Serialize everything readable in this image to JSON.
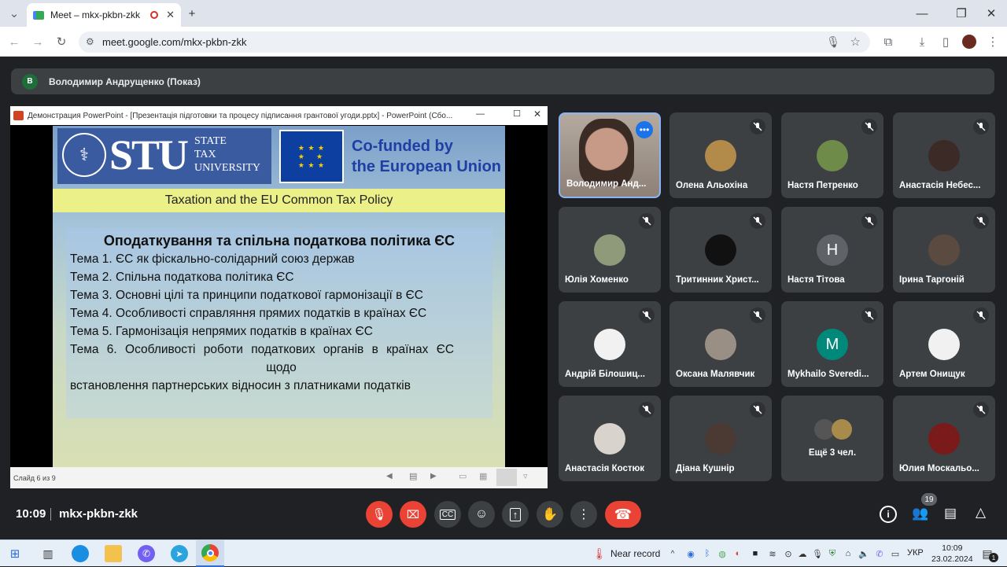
{
  "browser": {
    "tab_title": "Meet – mkx-pkbn-zkk",
    "url": "meet.google.com/mkx-pkbn-zkk"
  },
  "meet": {
    "presenter_initial": "В",
    "presenter_label": "Володимир Андрущенко (Показ)",
    "time": "10:09",
    "meeting_code": "mkx-pkbn-zkk",
    "participant_count": "19"
  },
  "ppt": {
    "window_title": "Демонстрация PowerPoint - [Презентація підготовки та процесу підписання грантової угоди.pptx] - PowerPoint (Сбо...",
    "status": "Слайд 6 из 9",
    "slide": {
      "logo_text": "STU",
      "logo_line1": "STATE",
      "logo_line2": "TAX",
      "logo_line3": "UNIVERSITY",
      "eu_line1": "Co-funded by",
      "eu_line2": "the European Union",
      "banner": "Taxation and the EU Common Tax Policy",
      "heading": "Оподаткування та спільна податкова політика ЄС",
      "items": [
        "Тема 1. ЄС як фіскально-солідарний союз держав",
        "Тема 2. Спільна податкова політика ЄС",
        "Тема 3. Основні цілі та принципи податкової гармонізації в ЄС",
        "Тема 4. Особливості справляння прямих податків в країнах ЄС",
        "Тема 5. Гармонізація непрямих податків в країнах ЄС",
        "Тема 6. Особливості роботи податкових органів в країнах ЄС",
        "щодо",
        "встановлення партнерських відносин з платниками податків"
      ]
    }
  },
  "tiles": [
    {
      "name": "Володимир Анд...",
      "type": "video"
    },
    {
      "name": "Олена Альохіна",
      "type": "photo",
      "color": "#b28a4a"
    },
    {
      "name": "Настя Петренко",
      "type": "photo",
      "color": "#6f8b4a"
    },
    {
      "name": "Анастасія Небес...",
      "type": "photo",
      "color": "#3b2a25"
    },
    {
      "name": "Юлія Хоменко",
      "type": "photo",
      "color": "#8f9a7a"
    },
    {
      "name": "Тритинник Христ...",
      "type": "photo",
      "color": "#111111"
    },
    {
      "name": "Настя Тітова",
      "type": "letter",
      "letter": "Н",
      "color": "#5f6368"
    },
    {
      "name": "Ірина Таргоній",
      "type": "photo",
      "color": "#5a4a40"
    },
    {
      "name": "Андрій Білошиц...",
      "type": "photo",
      "color": "#f1f1f1"
    },
    {
      "name": "Оксана Малявчик",
      "type": "photo",
      "color": "#9a8f85"
    },
    {
      "name": "Mykhailo Sveredi...",
      "type": "letter",
      "letter": "M",
      "color": "#00897b"
    },
    {
      "name": "Артем Онищук",
      "type": "photo",
      "color": "#f1f1f1"
    },
    {
      "name": "Анастасія Костюк",
      "type": "photo",
      "color": "#d8d3cc"
    },
    {
      "name": "Діана Кушнір",
      "type": "photo",
      "color": "#4a3a33"
    },
    {
      "name": "Ещё 3 чел.",
      "type": "more"
    },
    {
      "name": "Юлия Москальо...",
      "type": "photo",
      "color": "#7a1a1a"
    }
  ],
  "taskbar": {
    "near_record": "Near record",
    "lang": "УКР",
    "clock_time": "10:09",
    "clock_date": "23.02.2024",
    "notif": "1"
  }
}
